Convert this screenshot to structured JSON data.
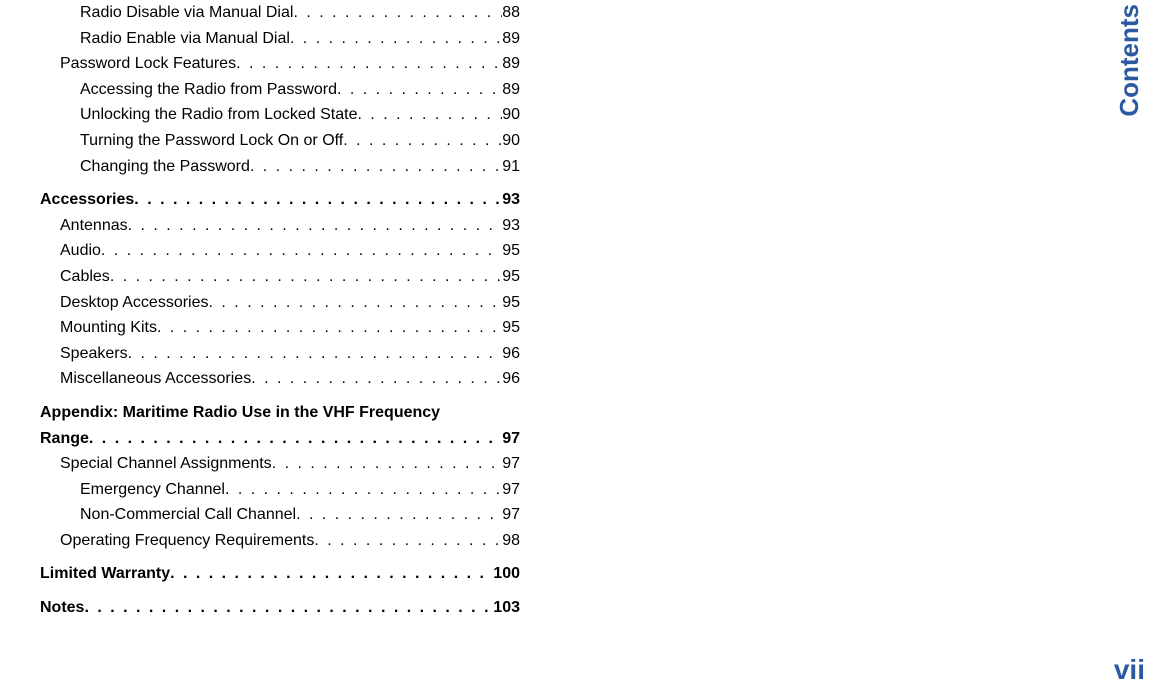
{
  "sideTab": "Contents",
  "pageNumber": "vii",
  "toc": [
    {
      "level": 2,
      "label": "Radio Disable via Manual Dial",
      "page": "88"
    },
    {
      "level": 2,
      "label": "Radio Enable via Manual Dial",
      "page": "89"
    },
    {
      "level": 1,
      "label": "Password Lock Features",
      "page": "89"
    },
    {
      "level": 2,
      "label": "Accessing the Radio from Password",
      "page": "89"
    },
    {
      "level": 2,
      "label": "Unlocking the Radio from Locked State",
      "page": "90"
    },
    {
      "level": 2,
      "label": "Turning the Password Lock On or Off",
      "page": "90"
    },
    {
      "level": 2,
      "label": "Changing the Password",
      "page": "91"
    },
    {
      "gap": true
    },
    {
      "level": 0,
      "label": "Accessories",
      "page": "93",
      "bold": true
    },
    {
      "level": 1,
      "label": "Antennas",
      "page": "93"
    },
    {
      "level": 1,
      "label": "Audio",
      "page": "95"
    },
    {
      "level": 1,
      "label": "Cables",
      "page": "95"
    },
    {
      "level": 1,
      "label": "Desktop Accessories",
      "page": "95"
    },
    {
      "level": 1,
      "label": "Mounting Kits",
      "page": "95"
    },
    {
      "level": 1,
      "label": "Speakers",
      "page": "96"
    },
    {
      "level": 1,
      "label": "Miscellaneous Accessories",
      "page": "96"
    },
    {
      "gap": true
    },
    {
      "level": 0,
      "labelLine1": "Appendix: Maritime Radio Use in the VHF Frequency",
      "label": "Range",
      "page": "97",
      "bold": true,
      "wrap": true
    },
    {
      "level": 1,
      "label": "Special Channel Assignments",
      "page": "97"
    },
    {
      "level": 2,
      "label": "Emergency Channel",
      "page": "97"
    },
    {
      "level": 2,
      "label": "Non-Commercial Call Channel",
      "page": "97"
    },
    {
      "level": 1,
      "label": "Operating Frequency Requirements",
      "page": "98"
    },
    {
      "gap": true
    },
    {
      "level": 0,
      "label": "Limited Warranty",
      "page": "100",
      "bold": true
    },
    {
      "gap": true
    },
    {
      "level": 0,
      "label": "Notes",
      "page": "103",
      "bold": true
    }
  ]
}
